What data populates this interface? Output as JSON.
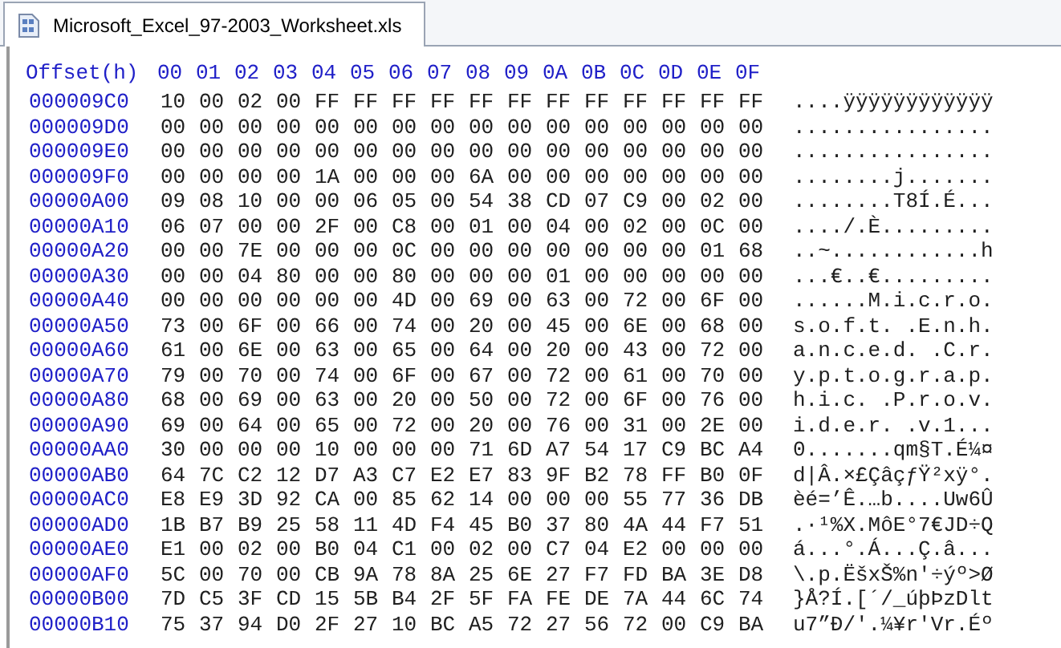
{
  "tabs": [
    {
      "label": "Microsoft_Excel_97-2003_Worksheet.xls",
      "selected": true
    }
  ],
  "header": {
    "offset_label": "Offset(h)",
    "columns": [
      "00",
      "01",
      "02",
      "03",
      "04",
      "05",
      "06",
      "07",
      "08",
      "09",
      "0A",
      "0B",
      "0C",
      "0D",
      "0E",
      "0F"
    ]
  },
  "rows": [
    {
      "offset": "000009C0",
      "bytes": [
        "10",
        "00",
        "02",
        "00",
        "FF",
        "FF",
        "FF",
        "FF",
        "FF",
        "FF",
        "FF",
        "FF",
        "FF",
        "FF",
        "FF",
        "FF"
      ],
      "ascii": "....ÿÿÿÿÿÿÿÿÿÿÿÿ"
    },
    {
      "offset": "000009D0",
      "bytes": [
        "00",
        "00",
        "00",
        "00",
        "00",
        "00",
        "00",
        "00",
        "00",
        "00",
        "00",
        "00",
        "00",
        "00",
        "00",
        "00"
      ],
      "ascii": "................"
    },
    {
      "offset": "000009E0",
      "bytes": [
        "00",
        "00",
        "00",
        "00",
        "00",
        "00",
        "00",
        "00",
        "00",
        "00",
        "00",
        "00",
        "00",
        "00",
        "00",
        "00"
      ],
      "ascii": "................"
    },
    {
      "offset": "000009F0",
      "bytes": [
        "00",
        "00",
        "00",
        "00",
        "1A",
        "00",
        "00",
        "00",
        "6A",
        "00",
        "00",
        "00",
        "00",
        "00",
        "00",
        "00"
      ],
      "ascii": "........j......."
    },
    {
      "offset": "00000A00",
      "bytes": [
        "09",
        "08",
        "10",
        "00",
        "00",
        "06",
        "05",
        "00",
        "54",
        "38",
        "CD",
        "07",
        "C9",
        "00",
        "02",
        "00"
      ],
      "ascii": "........T8Í.É..."
    },
    {
      "offset": "00000A10",
      "bytes": [
        "06",
        "07",
        "00",
        "00",
        "2F",
        "00",
        "C8",
        "00",
        "01",
        "00",
        "04",
        "00",
        "02",
        "00",
        "0C",
        "00"
      ],
      "ascii": "..../.È........."
    },
    {
      "offset": "00000A20",
      "bytes": [
        "00",
        "00",
        "7E",
        "00",
        "00",
        "00",
        "0C",
        "00",
        "00",
        "00",
        "00",
        "00",
        "00",
        "00",
        "01",
        "68"
      ],
      "ascii": "..~............h"
    },
    {
      "offset": "00000A30",
      "bytes": [
        "00",
        "00",
        "04",
        "80",
        "00",
        "00",
        "80",
        "00",
        "00",
        "00",
        "01",
        "00",
        "00",
        "00",
        "00",
        "00"
      ],
      "ascii": "...€..€........."
    },
    {
      "offset": "00000A40",
      "bytes": [
        "00",
        "00",
        "00",
        "00",
        "00",
        "00",
        "4D",
        "00",
        "69",
        "00",
        "63",
        "00",
        "72",
        "00",
        "6F",
        "00"
      ],
      "ascii": "......M.i.c.r.o."
    },
    {
      "offset": "00000A50",
      "bytes": [
        "73",
        "00",
        "6F",
        "00",
        "66",
        "00",
        "74",
        "00",
        "20",
        "00",
        "45",
        "00",
        "6E",
        "00",
        "68",
        "00"
      ],
      "ascii": "s.o.f.t. .E.n.h."
    },
    {
      "offset": "00000A60",
      "bytes": [
        "61",
        "00",
        "6E",
        "00",
        "63",
        "00",
        "65",
        "00",
        "64",
        "00",
        "20",
        "00",
        "43",
        "00",
        "72",
        "00"
      ],
      "ascii": "a.n.c.e.d. .C.r."
    },
    {
      "offset": "00000A70",
      "bytes": [
        "79",
        "00",
        "70",
        "00",
        "74",
        "00",
        "6F",
        "00",
        "67",
        "00",
        "72",
        "00",
        "61",
        "00",
        "70",
        "00"
      ],
      "ascii": "y.p.t.o.g.r.a.p."
    },
    {
      "offset": "00000A80",
      "bytes": [
        "68",
        "00",
        "69",
        "00",
        "63",
        "00",
        "20",
        "00",
        "50",
        "00",
        "72",
        "00",
        "6F",
        "00",
        "76",
        "00"
      ],
      "ascii": "h.i.c. .P.r.o.v."
    },
    {
      "offset": "00000A90",
      "bytes": [
        "69",
        "00",
        "64",
        "00",
        "65",
        "00",
        "72",
        "00",
        "20",
        "00",
        "76",
        "00",
        "31",
        "00",
        "2E",
        "00"
      ],
      "ascii": "i.d.e.r. .v.1..."
    },
    {
      "offset": "00000AA0",
      "bytes": [
        "30",
        "00",
        "00",
        "00",
        "10",
        "00",
        "00",
        "00",
        "71",
        "6D",
        "A7",
        "54",
        "17",
        "C9",
        "BC",
        "A4"
      ],
      "ascii": "0.......qm§T.É¼¤"
    },
    {
      "offset": "00000AB0",
      "bytes": [
        "64",
        "7C",
        "C2",
        "12",
        "D7",
        "A3",
        "C7",
        "E2",
        "E7",
        "83",
        "9F",
        "B2",
        "78",
        "FF",
        "B0",
        "0F"
      ],
      "ascii": "d|Â.×£ÇâçƒŸ²xÿ°."
    },
    {
      "offset": "00000AC0",
      "bytes": [
        "E8",
        "E9",
        "3D",
        "92",
        "CA",
        "00",
        "85",
        "62",
        "14",
        "00",
        "00",
        "00",
        "55",
        "77",
        "36",
        "DB"
      ],
      "ascii": "èé=’Ê.…b....Uw6Û"
    },
    {
      "offset": "00000AD0",
      "bytes": [
        "1B",
        "B7",
        "B9",
        "25",
        "58",
        "11",
        "4D",
        "F4",
        "45",
        "B0",
        "37",
        "80",
        "4A",
        "44",
        "F7",
        "51"
      ],
      "ascii": ".·¹%X.MôE°7€JD÷Q"
    },
    {
      "offset": "00000AE0",
      "bytes": [
        "E1",
        "00",
        "02",
        "00",
        "B0",
        "04",
        "C1",
        "00",
        "02",
        "00",
        "C7",
        "04",
        "E2",
        "00",
        "00",
        "00"
      ],
      "ascii": "á...°.Á...Ç.â..."
    },
    {
      "offset": "00000AF0",
      "bytes": [
        "5C",
        "00",
        "70",
        "00",
        "CB",
        "9A",
        "78",
        "8A",
        "25",
        "6E",
        "27",
        "F7",
        "FD",
        "BA",
        "3E",
        "D8"
      ],
      "ascii": "\\.p.ËšxŠ%n'÷ýº>Ø"
    },
    {
      "offset": "00000B00",
      "bytes": [
        "7D",
        "C5",
        "3F",
        "CD",
        "15",
        "5B",
        "B4",
        "2F",
        "5F",
        "FA",
        "FE",
        "DE",
        "7A",
        "44",
        "6C",
        "74"
      ],
      "ascii": "}Å?Í.[´/_úþÞzDlt"
    },
    {
      "offset": "00000B10",
      "bytes": [
        "75",
        "37",
        "94",
        "D0",
        "2F",
        "27",
        "10",
        "BC",
        "A5",
        "72",
        "27",
        "56",
        "72",
        "00",
        "C9",
        "BA"
      ],
      "ascii": "u7”Ð/'.¼¥r'Vr.Éº"
    }
  ]
}
